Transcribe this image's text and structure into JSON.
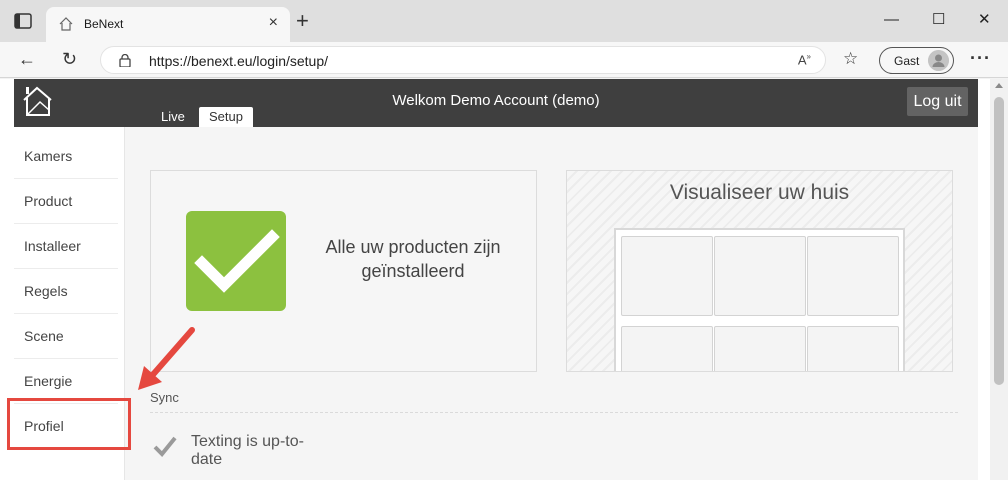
{
  "browser": {
    "tab_title": "BeNext",
    "url": "https://benext.eu/login/setup/",
    "profile_label": "Gast",
    "icons": [
      "window-icon",
      "favicon-house-icon",
      "close-tab-icon",
      "new-tab-icon",
      "minimize-icon",
      "maximize-icon",
      "close-window-icon",
      "back-icon",
      "refresh-icon",
      "lock-icon",
      "read-aloud-icon",
      "favorites-icon",
      "profile-avatar-icon",
      "more-icon"
    ]
  },
  "app": {
    "welcome": "Welkom Demo Account (demo)",
    "logout_label": "Log uit",
    "tabs": [
      {
        "label": "Live",
        "active": false
      },
      {
        "label": "Setup",
        "active": true
      }
    ]
  },
  "sidebar": {
    "items": [
      {
        "label": "Kamers"
      },
      {
        "label": "Product"
      },
      {
        "label": "Installeer"
      },
      {
        "label": "Regels"
      },
      {
        "label": "Scene"
      },
      {
        "label": "Energie"
      },
      {
        "label": "Profiel"
      }
    ]
  },
  "main": {
    "installed_text_line1": "Alle uw producten zijn",
    "installed_text_line2": "geïnstalleerd",
    "visualize_title": "Visualiseer uw huis",
    "sync_label": "Sync",
    "sync_status_line1": "Texting is up-to-",
    "sync_status_line2": "date"
  },
  "colors": {
    "header": "#3f3f3f",
    "check_green": "#8cc13f",
    "annotation_red": "#e5483f"
  }
}
